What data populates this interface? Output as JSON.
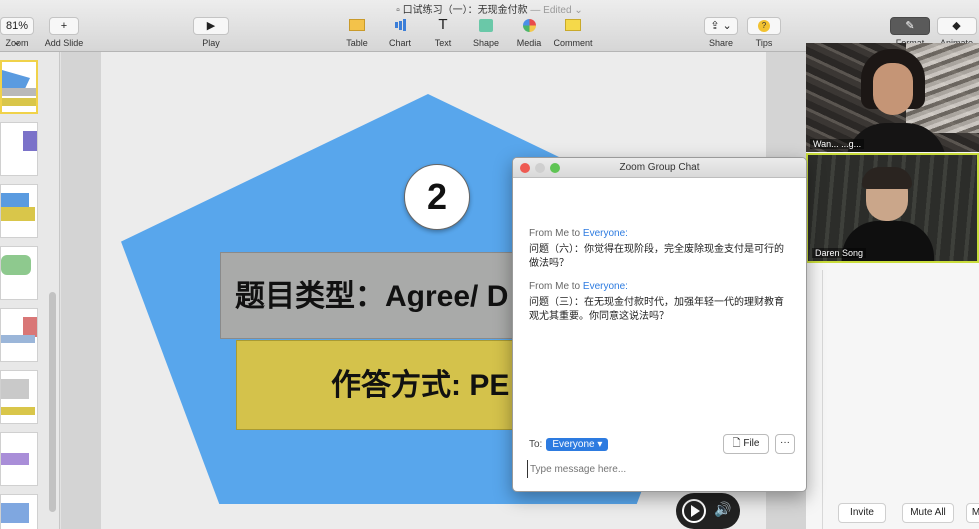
{
  "window": {
    "title": "口试练习（一）：无现金付款",
    "edited": "— Edited",
    "title_sep": " "
  },
  "toolbar": {
    "zoom_value": "81%",
    "zoom_label": "Zoom",
    "add_slide_label": "Add Slide",
    "play_label": "Play",
    "table_label": "Table",
    "chart_label": "Chart",
    "text_label": "Text",
    "shape_label": "Shape",
    "media_label": "Media",
    "comment_label": "Comment",
    "share_label": "Share",
    "tips_label": "Tips",
    "format_label": "Format",
    "animate_label": "Animate"
  },
  "slide": {
    "number": "2",
    "line1": "题目类型：Agree/ D",
    "line2": "作答方式: PE"
  },
  "thumbnails": [
    {
      "selected": true
    },
    {
      "selected": false
    },
    {
      "selected": false
    },
    {
      "selected": false
    },
    {
      "selected": false
    },
    {
      "selected": false
    },
    {
      "selected": false
    },
    {
      "selected": false
    }
  ],
  "videos": [
    {
      "name": "Wan... ...g..."
    },
    {
      "name": "Daren Song"
    }
  ],
  "chat": {
    "title": "Zoom Group Chat",
    "messages": [
      {
        "from": "From Me to ",
        "to": "Everyone:",
        "text": "问题（六）：你觉得在现阶段，完全废除现金支付是可行的做法吗？"
      },
      {
        "from": "From Me to ",
        "to": "Everyone:",
        "text": "问题（三）：在无现金付款时代，加强年轻一代的理财教育观尤其重要。你同意这说法吗？"
      }
    ],
    "to_label": "To:",
    "to_value": "Everyone",
    "file_label": "File",
    "more_label": "···",
    "input_placeholder": "Type message here..."
  },
  "participants_panel": {
    "invite_label": "Invite",
    "mute_all_label": "Mute All",
    "more_label": "M"
  },
  "colors": {
    "pentagon": "#58a6ec",
    "box1": "#a9aaa9",
    "box2": "#d4c24b",
    "accent": "#2d7be0",
    "active_speaker": "#c9dc3c"
  }
}
